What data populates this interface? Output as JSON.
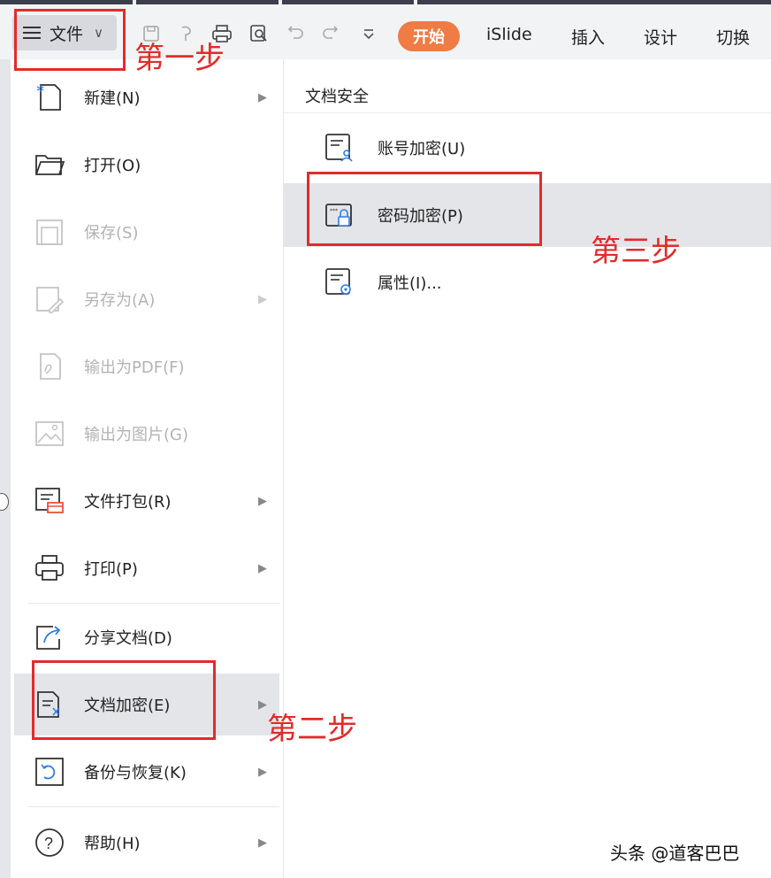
{
  "toolbar": {
    "file_label": "文件",
    "tabs": {
      "active": "开始",
      "islide": "iSlide",
      "insert": "插入",
      "design": "设计",
      "transition": "切换"
    }
  },
  "menu": {
    "new": "新建(N)",
    "open": "打开(O)",
    "save": "保存(S)",
    "save_as": "另存为(A)",
    "export_pdf": "输出为PDF(F)",
    "export_image": "输出为图片(G)",
    "package": "文件打包(R)",
    "print": "打印(P)",
    "share": "分享文档(D)",
    "encrypt": "文档加密(E)",
    "backup": "备份与恢复(K)",
    "help": "帮助(H)"
  },
  "submenu": {
    "title": "文档安全",
    "account_encrypt": "账号加密(U)",
    "password_encrypt": "密码加密(P)",
    "properties": "属性(I)..."
  },
  "annotations": {
    "step1": "第一步",
    "step2": "第二步",
    "step3": "第三步",
    "color": "#e22b2b"
  },
  "watermark": "头条 @道客巴巴"
}
